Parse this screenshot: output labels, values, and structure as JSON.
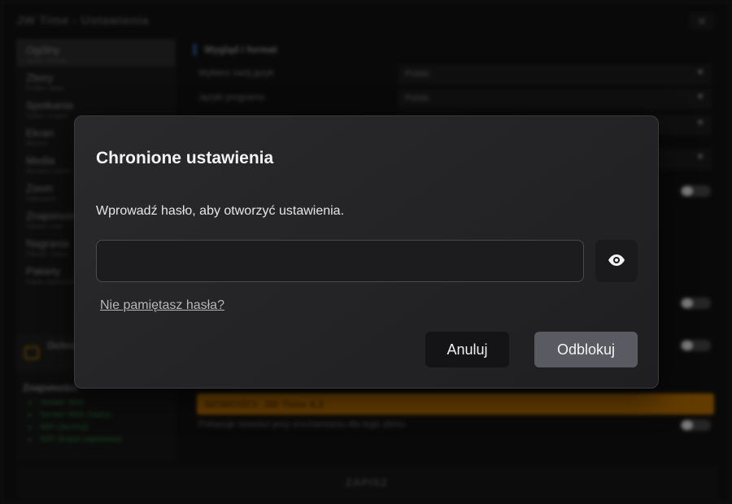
{
  "app": {
    "title": "JW Time - Ustawienia",
    "close_label": "✕",
    "sidebar": {
      "items": [
        {
          "label": "Ogólny",
          "sub": "Język i format"
        },
        {
          "label": "Zbory",
          "sub": "Profile i dane"
        },
        {
          "label": "Spotkania",
          "sub": "Czasy i części"
        },
        {
          "label": "Ekran",
          "sub": "Monitor"
        },
        {
          "label": "Media",
          "sub": "Muzyka i wideo"
        },
        {
          "label": "Zoom",
          "sub": "Odliczanie"
        },
        {
          "label": "Znajomości",
          "sub": "Serwer i sieć"
        },
        {
          "label": "Nagrania",
          "sub": "Dźwięk i zapis"
        },
        {
          "label": "Pakiety",
          "sub": "Kopia zapasowa"
        }
      ],
      "guard_title": "Ochrona",
      "remote_header": "Znajomości",
      "remote_items": [
        "Serwer Web",
        "Serwer Web Zdalny",
        "WiFi (lacznyj)",
        "WiFi (kopia zapasowa)"
      ]
    },
    "content": {
      "section_header": "Wygląd i format",
      "rows": [
        {
          "label": "Wybierz swój język",
          "value": "Polski"
        },
        {
          "label": "Języki programu",
          "value": "Polski"
        }
      ],
      "news_banner": "NOWOŚCI: JW Time 4.2",
      "news_row_label": "Pokazuje nowości przy uruchamianiu dla tego zboru"
    },
    "save_label": "ZAPISZ"
  },
  "dialog": {
    "title": "Chronione ustawienia",
    "description": "Wprowadź hasło, aby otworzyć ustawienia.",
    "password_value": "",
    "password_placeholder": "",
    "show_password_icon": "eye-icon",
    "forgot_link": "Nie pamiętasz hasła?",
    "cancel_label": "Anuluj",
    "unlock_label": "Odblokuj"
  },
  "colors": {
    "accent": "#2f6bcf",
    "news": "#b36c00",
    "dialog_bg": "#262628",
    "unlock_btn": "#5a5a62"
  }
}
